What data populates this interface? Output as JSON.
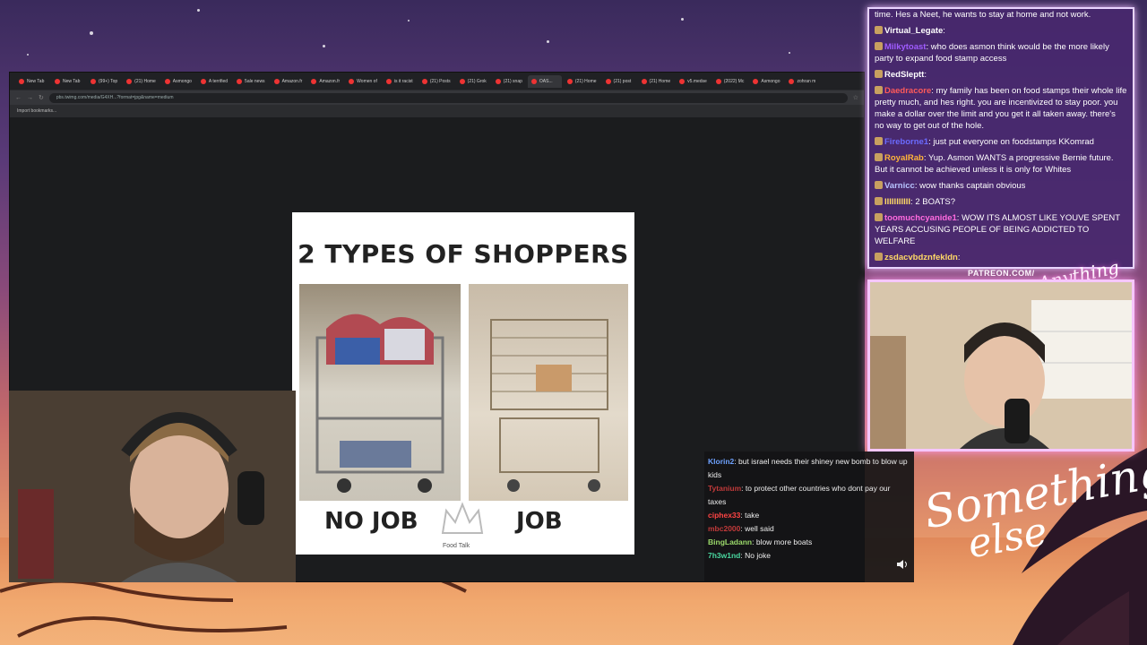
{
  "browser": {
    "tabs": [
      {
        "label": "New Tab"
      },
      {
        "label": "New Tab"
      },
      {
        "label": "(99+) Top"
      },
      {
        "label": "(21) Home"
      },
      {
        "label": "Asmongo"
      },
      {
        "label": "A terrified"
      },
      {
        "label": "5ale news"
      },
      {
        "label": "Amazon.fr"
      },
      {
        "label": "Amazon.fr"
      },
      {
        "label": "Women of"
      },
      {
        "label": "is it racist"
      },
      {
        "label": "(21) Posts"
      },
      {
        "label": "(21) Grok"
      },
      {
        "label": "(21) snap"
      },
      {
        "label": "OAS...",
        "active": true
      },
      {
        "label": "(21) Home"
      },
      {
        "label": "(21) post"
      },
      {
        "label": "(21) Home"
      },
      {
        "label": "v5.medse"
      },
      {
        "label": "(2022) Mc"
      },
      {
        "label": "Asmongo"
      },
      {
        "label": "zohran m"
      }
    ],
    "url": "pbs.twimg.com/media/G4XH...?format=jpg&name=medium",
    "bookmarks_label": "Import bookmarks..."
  },
  "meme": {
    "title": "2 TYPES OF SHOPPERS",
    "left_label": "NO JOB",
    "right_label": "JOB",
    "watermark_text": "Food Talk"
  },
  "chat_top": [
    {
      "user": "",
      "text": "time. Hes a Neet, he wants to stay at home and not work.",
      "color": "#ffffff"
    },
    {
      "user": "Virtual_Legate",
      "text": "",
      "color": "#ffffff"
    },
    {
      "user": "Milkytoast",
      "text": "who does asmon think would be the more likely party to expand food stamp access",
      "color": "#a05cff"
    },
    {
      "user": "RedSleptt",
      "text": "",
      "color": "#ffffff"
    },
    {
      "user": "Daedracore",
      "text": "my family has been on food stamps their whole life pretty much, and hes right. you are incentivized to stay poor. you make a dollar over the limit and you get it all taken away. there's no way to get out of the hole.",
      "color": "#ff5a5a"
    },
    {
      "user": "Fireborne1",
      "text": "just put everyone on foodstamps KKomrad",
      "color": "#6b6bff"
    },
    {
      "user": "RoyalRab",
      "text": "Yup. Asmon WANTS a progressive Bernie future. But it cannot be achieved unless it is only for Whites",
      "color": "#ffb43a"
    },
    {
      "user": "Varnicc",
      "text": "wow thanks captain obvious",
      "color": "#b8c4ff"
    },
    {
      "user": "IIIIIIIIIII",
      "text": "2 BOATS?",
      "color": "#ffd966"
    },
    {
      "user": "toomuchcyanide1",
      "text": "WOW ITS ALMOST LIKE YOUVE SPENT YEARS ACCUSING PEOPLE OF BEING ADDICTED TO WELFARE",
      "color": "#ff6adf"
    },
    {
      "user": "zsdacvbdznfekldn",
      "text": "",
      "color": "#ffd966"
    }
  ],
  "chat_bottom": [
    {
      "user": "Klorin2",
      "text": "but israel needs their shiney new bomb to blow up kids",
      "color": "#6ea2ff"
    },
    {
      "user": "Tytanium",
      "text": "to protect other countries who dont pay our taxes",
      "color": "#c03a3a"
    },
    {
      "user": "ciphex33",
      "text": "take",
      "color": "#ff4444"
    },
    {
      "user": "mbc2000",
      "text": "well said",
      "color": "#c03a3a"
    },
    {
      "user": "BingLadann",
      "text": "blow more boats",
      "color": "#9ad86a"
    },
    {
      "user": "7h3w1nd",
      "text": "No joke",
      "color": "#4ad8a0"
    }
  ],
  "overlay": {
    "patreon": "PATREON.COM/",
    "logo_small": "Anything else?",
    "logo_big_line1": "Something",
    "logo_big_line2": "else"
  }
}
